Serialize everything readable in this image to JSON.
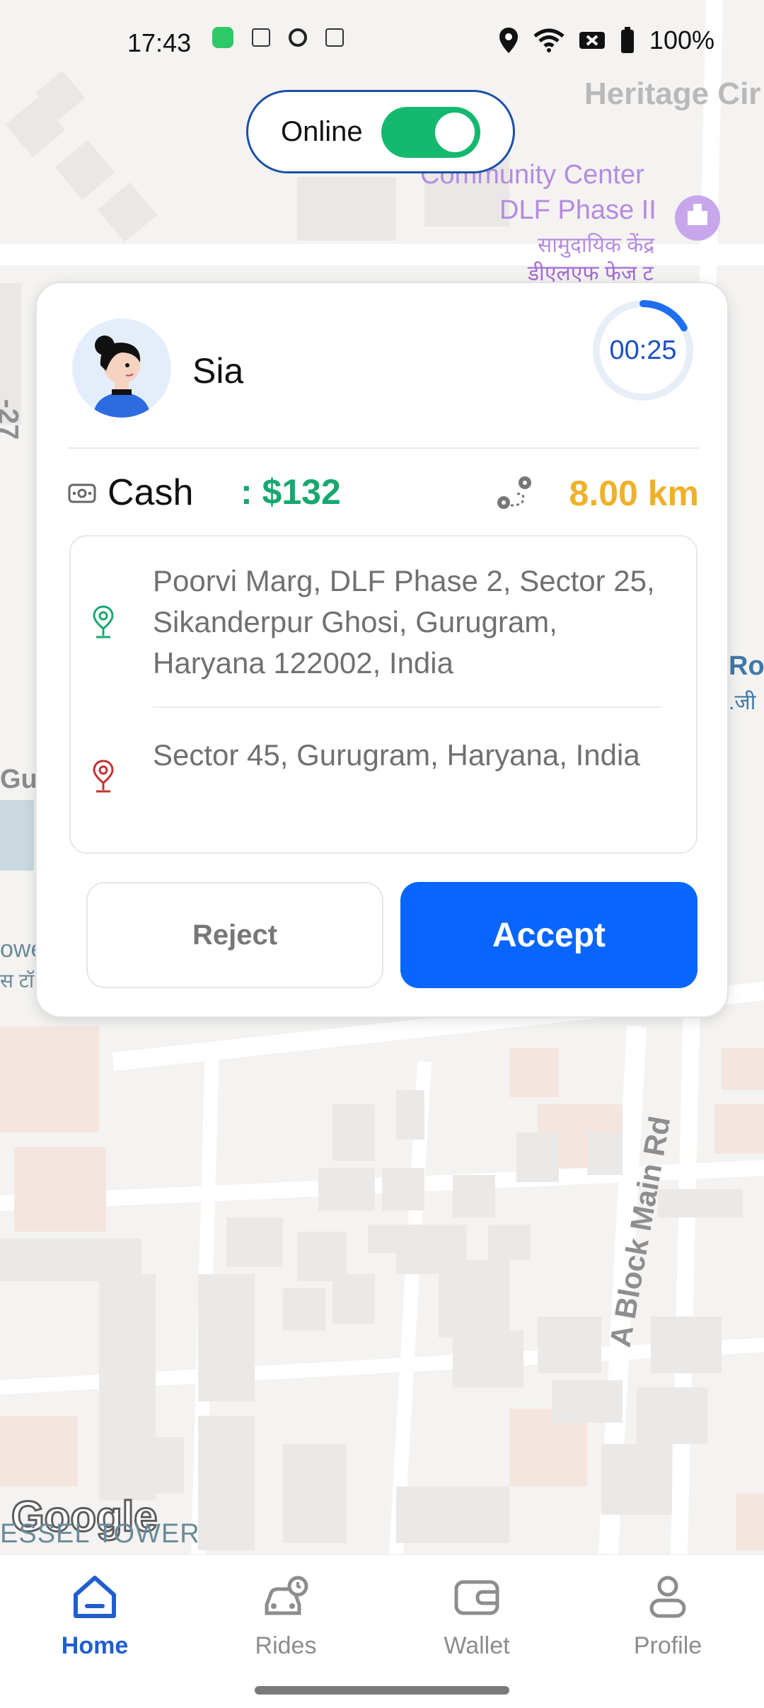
{
  "status_bar": {
    "time": "17:43",
    "battery": "100%"
  },
  "online_toggle": {
    "label": "Online",
    "state": "on"
  },
  "map_labels": {
    "heritage": "Heritage Cir",
    "community_center": "Community Center",
    "dlf_phase": "DLF Phase II",
    "hindi_1": "सामुदायिक केंद्र",
    "hindi_2": "डीएलएफ फेज ट",
    "road_right": "Ro",
    "road_right_hindi": ".जी",
    "left_gu": "Gu",
    "left_owe": "owe",
    "left_hindi": "स टॉ",
    "side_27": "-27",
    "block_main_rd": "A Block Main Rd",
    "google": "Google",
    "tower": "ESSEL TOWER"
  },
  "ride_request": {
    "rider_name": "Sia",
    "timer": "00:25",
    "timer_progress": 0.17,
    "payment_label": "Cash",
    "amount": ": $132",
    "distance": "8.00 km",
    "pickup_address": "Poorvi Marg, DLF Phase 2, Sector 25, Sikanderpur Ghosi, Gurugram, Haryana 122002, India",
    "drop_address": "Sector 45, Gurugram, Haryana, India",
    "reject_label": "Reject",
    "accept_label": "Accept"
  },
  "nav": {
    "items": [
      {
        "label": "Home",
        "icon": "home-icon",
        "active": true
      },
      {
        "label": "Rides",
        "icon": "rides-icon",
        "active": false
      },
      {
        "label": "Wallet",
        "icon": "wallet-icon",
        "active": false
      },
      {
        "label": "Profile",
        "icon": "profile-icon",
        "active": false
      }
    ]
  },
  "colors": {
    "accent": "#0866ff",
    "online_green": "#14b86e",
    "cash_green": "#17a870",
    "distance_yellow": "#efb12a",
    "nav_active": "#1f5fd0"
  }
}
